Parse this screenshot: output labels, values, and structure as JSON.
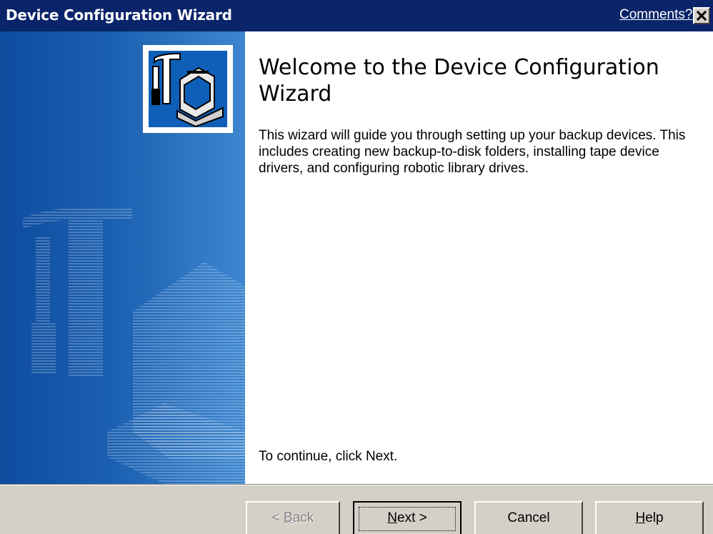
{
  "window": {
    "title": "Device Configuration Wizard",
    "comments_link": "Comments?",
    "close_glyph": "✕"
  },
  "side_panel": {
    "logo_icon": "tools-and-computer-icon",
    "watermark_icon": "tools-and-computer-watermark-icon"
  },
  "main": {
    "heading": "Welcome to the Device Configuration Wizard",
    "description": "This wizard will guide you through setting up your backup devices.  This includes creating new backup-to-disk folders, installing tape device drivers, and configuring robotic library drives.",
    "continue_text": "To continue, click Next."
  },
  "buttons": {
    "back": {
      "prefix": "< ",
      "mnemonic": "B",
      "rest": "ack",
      "enabled": false
    },
    "next": {
      "mnemonic": "N",
      "rest": "ext >",
      "enabled": true,
      "focused": true
    },
    "cancel": {
      "label": "Cancel",
      "enabled": true
    },
    "help": {
      "mnemonic": "H",
      "rest": "elp",
      "enabled": true
    }
  },
  "colors": {
    "titlebar": "#0a246a",
    "side_panel": "#1b5fb0",
    "dialog_face": "#d4d0c8"
  }
}
